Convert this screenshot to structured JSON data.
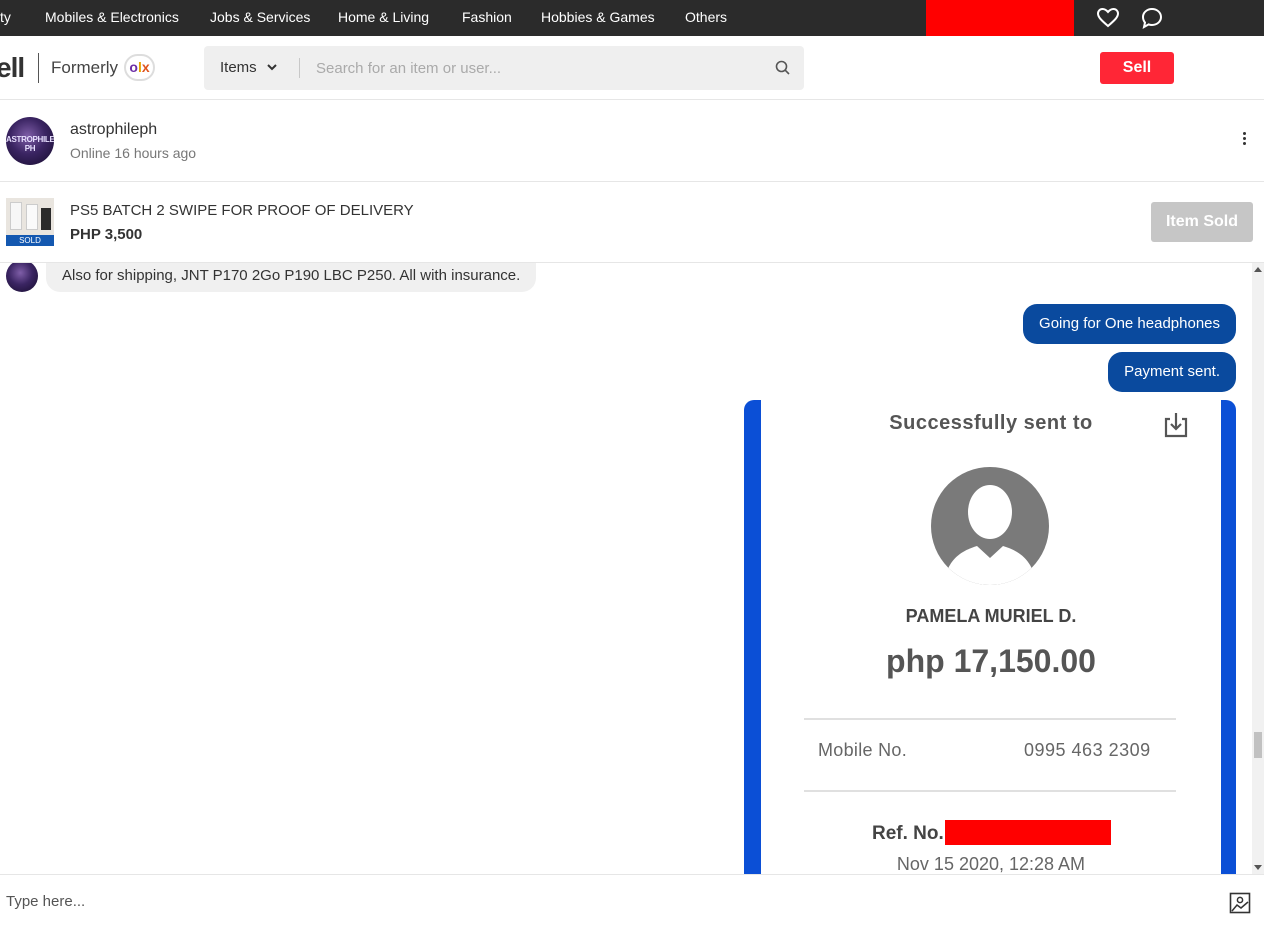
{
  "topnav": {
    "categories": [
      "ty",
      "Mobiles & Electronics",
      "Jobs & Services",
      "Home & Living",
      "Fashion",
      "Hobbies & Games",
      "Others"
    ],
    "icons": [
      "heart-icon",
      "chat-bubble-icon"
    ]
  },
  "header": {
    "logo_text": "ell",
    "formerly_text": "Formerly",
    "olx_text": "OLX",
    "search": {
      "category": "Items",
      "placeholder": "Search for an item or user..."
    },
    "sell_label": "Sell"
  },
  "conversation": {
    "username": "astrophileph",
    "avatar_text": "ASTROPHILE PH",
    "status": "Online 16 hours ago",
    "item": {
      "title": "PS5 BATCH 2 SWIPE FOR PROOF OF DELIVERY",
      "price": "PHP 3,500",
      "badge": "SOLD",
      "status_button": "Item Sold"
    }
  },
  "messages": {
    "incoming": "Also for shipping, JNT P170 2Go P190 LBC P250. All with insurance.",
    "outgoing": [
      "Going for One headphones",
      "Payment sent."
    ],
    "receipt": {
      "title": "Successfully sent to",
      "recipient": "PAMELA MURIEL D.",
      "amount": "php 17,150.00",
      "mobile_label": "Mobile No.",
      "mobile_value": "0995 463 2309",
      "ref_label": "Ref. No.",
      "date": "Nov 15 2020, 12:28 AM"
    }
  },
  "composer": {
    "placeholder": "Type here..."
  },
  "colors": {
    "topbar": "#2b2b2b",
    "sell": "#ff2636",
    "outgoing_bubble": "#0a4a9e",
    "receipt_border": "#0b4fd6",
    "redaction": "#ff0000"
  }
}
